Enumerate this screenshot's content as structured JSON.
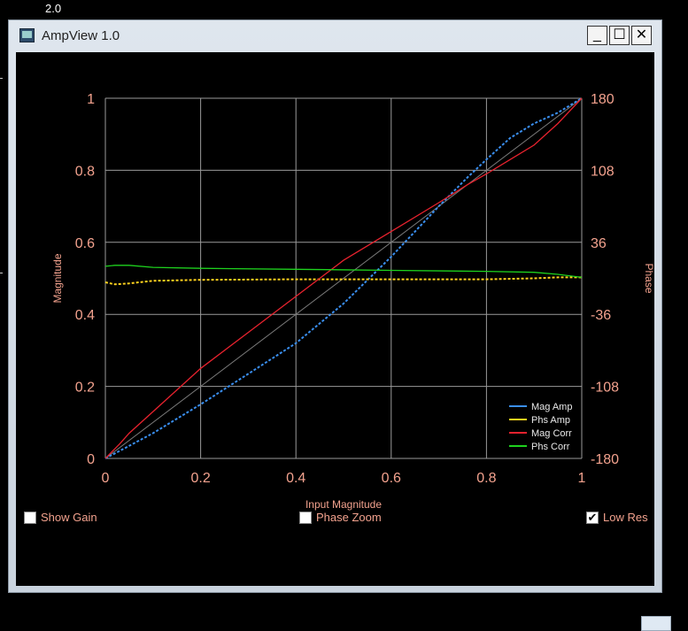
{
  "desktop": {
    "label": "2.0"
  },
  "window": {
    "title": "AmpView 1.0",
    "minimize": "_",
    "maximize": "☐",
    "close": "✕"
  },
  "controls": {
    "show_gain": {
      "label": "Show Gain",
      "checked": false
    },
    "phase_zoom": {
      "label": "Phase Zoom",
      "checked": false
    },
    "low_res": {
      "label": "Low Res",
      "checked": true
    }
  },
  "colors": {
    "axis_text": "#f3a28e",
    "grid": "#9a9a9a",
    "background": "#000000"
  },
  "chart_data": {
    "type": "line",
    "xlabel": "Input Magnitude",
    "ylabel": "Magnitude",
    "y2label": "Phase",
    "xlim": [
      0,
      1
    ],
    "ylim": [
      0,
      1
    ],
    "y2lim": [
      -180,
      180
    ],
    "xticks": [
      "0",
      "0.2",
      "0.4",
      "0.6",
      "0.8",
      "1"
    ],
    "yticks": [
      "0",
      "0.2",
      "0.4",
      "0.6",
      "0.8",
      "1"
    ],
    "y2ticks": [
      "-180",
      "-108",
      "-36",
      "36",
      "108",
      "180"
    ],
    "grid": true,
    "legend_position": "bottom-right",
    "series": [
      {
        "name": "Mag Amp",
        "color": "#3a8ff0",
        "style": "dashed",
        "axis": "left",
        "x": [
          0,
          0.05,
          0.1,
          0.2,
          0.3,
          0.4,
          0.5,
          0.6,
          0.7,
          0.76,
          0.8,
          0.85,
          0.9,
          0.95,
          1.0
        ],
        "y": [
          0,
          0.035,
          0.07,
          0.15,
          0.235,
          0.32,
          0.43,
          0.56,
          0.7,
          0.78,
          0.83,
          0.89,
          0.93,
          0.96,
          1.0
        ]
      },
      {
        "name": "Phs Amp",
        "color": "#ffd21e",
        "style": "dashed",
        "axis": "right",
        "x": [
          0,
          0.02,
          0.05,
          0.1,
          0.2,
          0.4,
          0.6,
          0.8,
          0.9,
          0.95,
          1.0
        ],
        "y": [
          -4,
          -6,
          -5,
          -2.5,
          -1.5,
          -1,
          -1,
          -1,
          0,
          1,
          1
        ]
      },
      {
        "name": "Mag Corr",
        "color": "#e8222e",
        "style": "solid",
        "axis": "left",
        "x": [
          0,
          0.03,
          0.05,
          0.1,
          0.2,
          0.3,
          0.4,
          0.5,
          0.6,
          0.7,
          0.76,
          0.8,
          0.85,
          0.9,
          0.95,
          1.0
        ],
        "y": [
          0,
          0.04,
          0.07,
          0.13,
          0.25,
          0.35,
          0.45,
          0.55,
          0.63,
          0.71,
          0.76,
          0.79,
          0.83,
          0.87,
          0.93,
          1.0
        ]
      },
      {
        "name": "Phs Corr",
        "color": "#1ed21e",
        "style": "solid",
        "axis": "right",
        "x": [
          0,
          0.02,
          0.05,
          0.1,
          0.2,
          0.4,
          0.6,
          0.8,
          0.9,
          0.95,
          1.0
        ],
        "y": [
          12,
          13,
          13,
          11,
          10,
          9,
          8,
          7,
          6,
          4,
          1
        ]
      }
    ]
  }
}
